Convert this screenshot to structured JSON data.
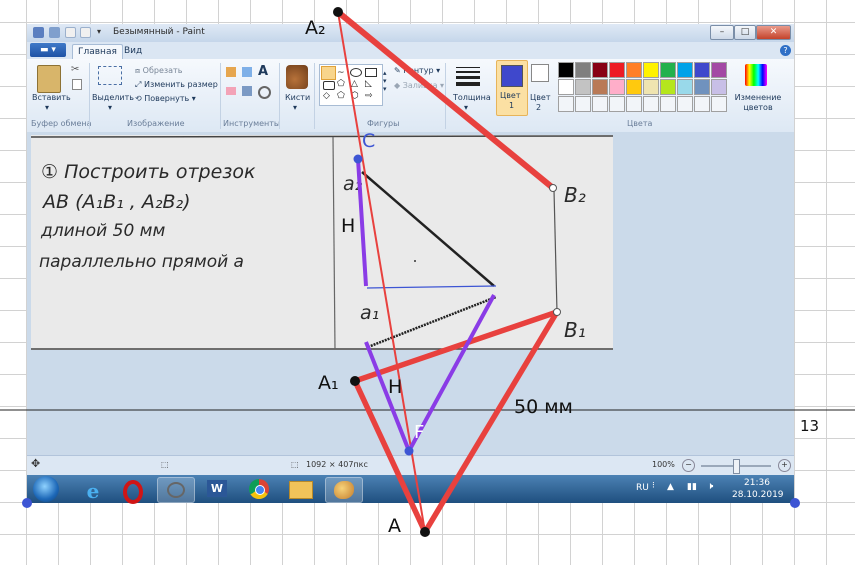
{
  "paint": {
    "title": "Безымянный - Paint",
    "tabs": {
      "file": "",
      "home": "Главная",
      "view": "Вид"
    },
    "clipboard": {
      "paste_label": "Вставить",
      "group_label": "Буфер обмена"
    },
    "image": {
      "select_label": "Выделить",
      "crop_label": "Обрезать",
      "resize_label": "Изменить размер",
      "rotate_label": "Повернуть",
      "group_label": "Изображение"
    },
    "tools": {
      "group_label": "Инструменты",
      "brushes_label": "Кисти"
    },
    "shapes": {
      "group_label": "Фигуры",
      "outline_label": "Контур",
      "fill_label": "Заливка"
    },
    "size_label": "Толщина",
    "color1_label": "Цвет",
    "color1_index": "1",
    "color2_label": "Цвет",
    "color2_index": "2",
    "colors_group_label": "Цвета",
    "edit_colors_label": "Изменение цветов",
    "palette": [
      "#000000",
      "#7f7f7f",
      "#880015",
      "#ed1c24",
      "#ff7f27",
      "#fff200",
      "#22b14c",
      "#00a2e8",
      "#3f48cc",
      "#a349a4",
      "#ffffff",
      "#c3c3c3",
      "#b97a57",
      "#ffaec9",
      "#ffc90e",
      "#efe4b0",
      "#b5e61d",
      "#99d9ea",
      "#7092be",
      "#c8bfe7"
    ],
    "status": {
      "dimensions": "1092 × 407пкс",
      "zoom": "100%"
    }
  },
  "drawing_text": {
    "line1": "① Построить отрезок",
    "line2": "АВ (А₁В₁ , А₂В₂)",
    "line3": "длиной 50 мм",
    "line4": "параллельно прямой а",
    "a2": "а₂",
    "a1": "а₁",
    "b2": "В₂",
    "b1": "В₁"
  },
  "taskbar": {
    "lang": "RU",
    "time": "21:36",
    "date": "28.10.2019"
  },
  "overlay": {
    "A2": "A₂",
    "A1": "A₁",
    "A": "A",
    "C": "C",
    "F": "F",
    "H_top": "H",
    "H_bottom": "H",
    "length": "50 мм",
    "axis_number": "13"
  },
  "colors": {
    "red_segment": "#e8413e",
    "purple_segment": "#8a3ce6",
    "point": "#111111",
    "blue_point": "#3d55d4"
  }
}
